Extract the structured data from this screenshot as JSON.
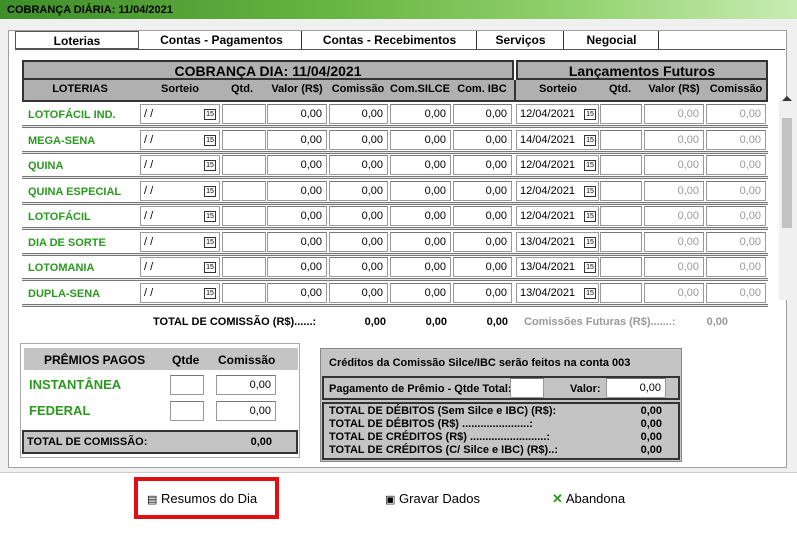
{
  "window": {
    "title": "COBRANÇA DIÁRIA: 11/04/2021"
  },
  "tabs": [
    "Loterias",
    "Contas - Pagamentos",
    "Contas - Recebimentos",
    "Serviços",
    "Negocial"
  ],
  "main_header": "COBRANÇA DIA: 11/04/2021",
  "future_header": "Lançamentos Futuros",
  "columns": {
    "loterias": "LOTERIAS",
    "sorteio": "Sorteio",
    "qtd": "Qtd.",
    "valor": "Valor (R$)",
    "comissao": "Comissão",
    "com_silce": "Com.SILCE",
    "com_ibc": "Com. IBC",
    "f_sorteio": "Sorteio",
    "f_qtd": "Qtd.",
    "f_valor": "Valor (R$)",
    "f_comissao": "Comissão"
  },
  "rows": [
    {
      "name": "LOTOFÁCIL IND.",
      "sorteio": " / /",
      "valor": "0,00",
      "comissao": "0,00",
      "silce": "0,00",
      "ibc": "0,00",
      "fdate": "12/04/2021",
      "fvalor": "0,00",
      "fcom": "0,00"
    },
    {
      "name": "MEGA-SENA",
      "sorteio": " / /",
      "valor": "0,00",
      "comissao": "0,00",
      "silce": "0,00",
      "ibc": "0,00",
      "fdate": "14/04/2021",
      "fvalor": "0,00",
      "fcom": "0,00"
    },
    {
      "name": "QUINA",
      "sorteio": " / /",
      "valor": "0,00",
      "comissao": "0,00",
      "silce": "0,00",
      "ibc": "0,00",
      "fdate": "12/04/2021",
      "fvalor": "0,00",
      "fcom": "0,00"
    },
    {
      "name": "QUINA ESPECIAL",
      "sorteio": " / /",
      "valor": "0,00",
      "comissao": "0,00",
      "silce": "0,00",
      "ibc": "0,00",
      "fdate": "12/04/2021",
      "fvalor": "0,00",
      "fcom": "0,00"
    },
    {
      "name": "LOTOFÁCIL",
      "sorteio": " / /",
      "valor": "0,00",
      "comissao": "0,00",
      "silce": "0,00",
      "ibc": "0,00",
      "fdate": "12/04/2021",
      "fvalor": "0,00",
      "fcom": "0,00"
    },
    {
      "name": "DIA DE SORTE",
      "sorteio": " / /",
      "valor": "0,00",
      "comissao": "0,00",
      "silce": "0,00",
      "ibc": "0,00",
      "fdate": "13/04/2021",
      "fvalor": "0,00",
      "fcom": "0,00"
    },
    {
      "name": "LOTOMANIA",
      "sorteio": " / /",
      "valor": "0,00",
      "comissao": "0,00",
      "silce": "0,00",
      "ibc": "0,00",
      "fdate": "13/04/2021",
      "fvalor": "0,00",
      "fcom": "0,00"
    },
    {
      "name": "DUPLA-SENA",
      "sorteio": " / /",
      "valor": "0,00",
      "comissao": "0,00",
      "silce": "0,00",
      "ibc": "0,00",
      "fdate": "13/04/2021",
      "fvalor": "0,00",
      "fcom": "0,00"
    }
  ],
  "totals": {
    "label": "TOTAL DE COMISSÃO (R$)......:",
    "comissao": "0,00",
    "silce": "0,00",
    "ibc": "0,00",
    "future_label": "Comissões Futuras (R$).......:",
    "future": "0,00"
  },
  "premios": {
    "header": "PRÊMIOS PAGOS",
    "qtde": "Qtde",
    "comissao": "Comissão",
    "instantanea": "INSTANTÂNEA",
    "instantanea_val": "0,00",
    "federal": "FEDERAL",
    "federal_val": "0,00",
    "total_label": "TOTAL DE COMISSÃO:",
    "total_val": "0,00"
  },
  "summary": {
    "credit_note": "Créditos da Comissão Silce/IBC serão feitos na conta 003",
    "pagamento_label": "Pagamento de Prêmio - Qtde Total:",
    "valor_label": "Valor:",
    "valor": "0,00",
    "lines": [
      {
        "label": "TOTAL DE DÉBITOS (Sem Silce e IBC) (R$):",
        "val": "0,00"
      },
      {
        "label": "TOTAL DE DÉBITOS (R$) ......................:",
        "val": "0,00"
      },
      {
        "label": "TOTAL DE CRÉDITOS (R$) .........................:",
        "val": "0,00"
      },
      {
        "label": "TOTAL DE CRÉDITOS (C/ Silce e IBC) (R$)..:",
        "val": "0,00"
      }
    ]
  },
  "buttons": {
    "resumos": "Resumos do Dia",
    "gravar": "Gravar Dados",
    "abandona": "Abandona"
  },
  "colors": {
    "accent_green": "#2a9a1e",
    "highlight_red": "#e01010"
  }
}
